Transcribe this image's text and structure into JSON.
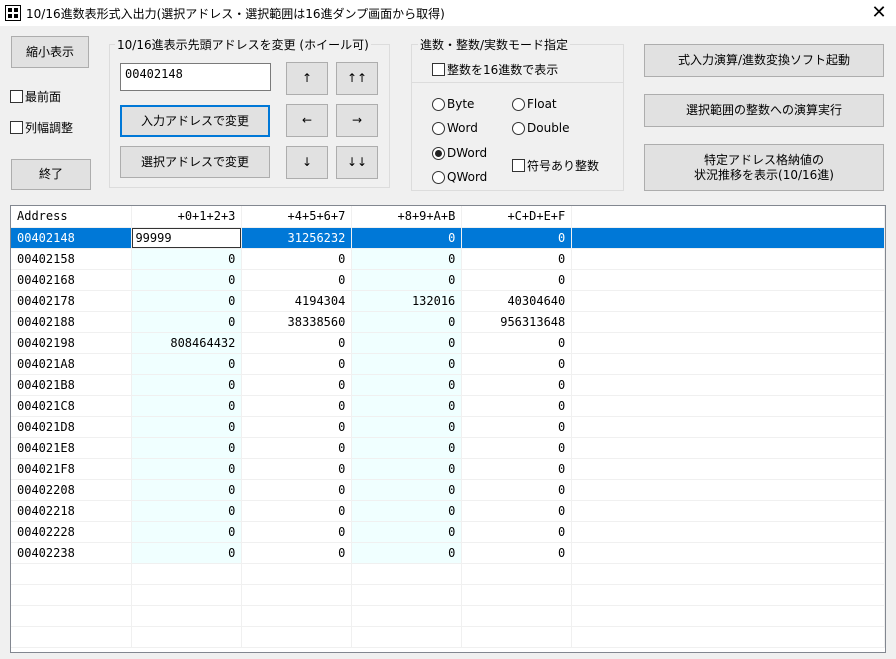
{
  "window": {
    "title": "10/16進数表形式入出力(選択アドレス・選択範囲は16進ダンプ画面から取得)",
    "close_glyph": "✕"
  },
  "left": {
    "shrink_label": "縮小表示",
    "topmost_label": "最前面",
    "col_adjust_label": "列幅調整",
    "exit_label": "終了"
  },
  "address_group": {
    "title": "10/16進表示先頭アドレスを変更 (ホイール可)",
    "address_value": "00402148",
    "apply_input_label": "入力アドレスで変更",
    "apply_selected_label": "選択アドレスで変更",
    "arrows": {
      "up": "↑",
      "up_up": "↑↑",
      "left": "←",
      "right": "→",
      "down": "↓",
      "down_down": "↓↓"
    }
  },
  "mode_group": {
    "title": "進数・整数/実数モード指定",
    "hex_int_label": "整数を16進数で表示",
    "types": [
      "Byte",
      "Float",
      "Word",
      "Double",
      "DWord",
      "QWord"
    ],
    "selected_type": "DWord",
    "signed_label": "符号あり整数"
  },
  "right": {
    "launch_calc_label": "式入力演算/進数変換ソフト起動",
    "range_calc_label": "選択範囲の整数への演算実行",
    "history_label": [
      "特定アドレス格納値の",
      "状況推移を表示(10/16進)"
    ]
  },
  "grid": {
    "columns": [
      "Address",
      "+0+1+2+3",
      "+4+5+6+7",
      "+8+9+A+B",
      "+C+D+E+F"
    ],
    "rows": [
      [
        "00402148",
        "99999",
        "31256232",
        "0",
        "0"
      ],
      [
        "00402158",
        "0",
        "0",
        "0",
        "0"
      ],
      [
        "00402168",
        "0",
        "0",
        "0",
        "0"
      ],
      [
        "00402178",
        "0",
        "4194304",
        "132016",
        "40304640"
      ],
      [
        "00402188",
        "0",
        "38338560",
        "0",
        "956313648"
      ],
      [
        "00402198",
        "808464432",
        "0",
        "0",
        "0"
      ],
      [
        "004021A8",
        "0",
        "0",
        "0",
        "0"
      ],
      [
        "004021B8",
        "0",
        "0",
        "0",
        "0"
      ],
      [
        "004021C8",
        "0",
        "0",
        "0",
        "0"
      ],
      [
        "004021D8",
        "0",
        "0",
        "0",
        "0"
      ],
      [
        "004021E8",
        "0",
        "0",
        "0",
        "0"
      ],
      [
        "004021F8",
        "0",
        "0",
        "0",
        "0"
      ],
      [
        "00402208",
        "0",
        "0",
        "0",
        "0"
      ],
      [
        "00402218",
        "0",
        "0",
        "0",
        "0"
      ],
      [
        "00402228",
        "0",
        "0",
        "0",
        "0"
      ],
      [
        "00402238",
        "0",
        "0",
        "0",
        "0"
      ]
    ],
    "selected_row": 0,
    "empty_rows": 4,
    "colors": {
      "selection": "#0078d7",
      "alt_column": "#f0ffff"
    }
  }
}
